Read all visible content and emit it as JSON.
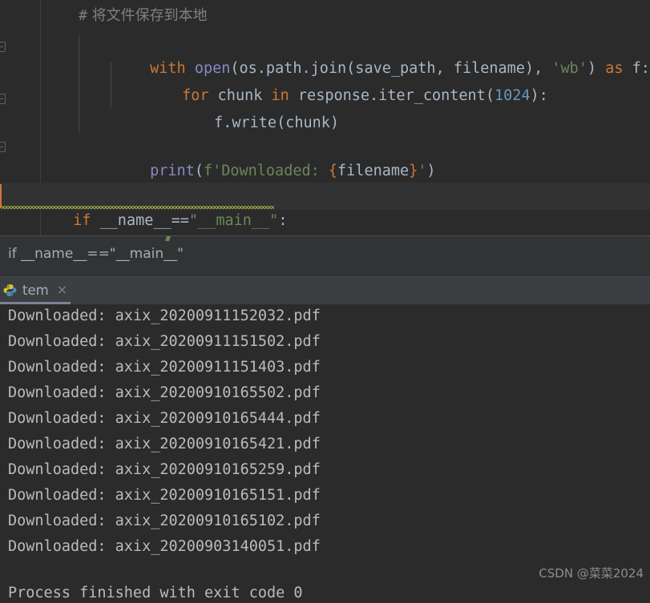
{
  "editor": {
    "comment_line": "# 将文件保存到本地",
    "comment_hash": "#",
    "comment_text": " 将文件保存到本地",
    "lines": [
      {
        "indent": 0,
        "tokens": [
          {
            "t": "with",
            "c": "kw"
          },
          {
            "t": " ",
            "c": "plain"
          },
          {
            "t": "open",
            "c": "fn"
          },
          {
            "t": "(os.path.join(save_path, filename), ",
            "c": "plain"
          },
          {
            "t": "'wb'",
            "c": "str"
          },
          {
            "t": ") ",
            "c": "plain"
          },
          {
            "t": "as",
            "c": "kw"
          },
          {
            "t": " f:",
            "c": "plain"
          }
        ]
      },
      {
        "indent": 1,
        "tokens": [
          {
            "t": "for",
            "c": "kw"
          },
          {
            "t": " chunk ",
            "c": "plain"
          },
          {
            "t": "in",
            "c": "kw"
          },
          {
            "t": " response.iter_content(",
            "c": "plain"
          },
          {
            "t": "1024",
            "c": "num"
          },
          {
            "t": "):",
            "c": "plain"
          }
        ]
      },
      {
        "indent": 2,
        "tokens": [
          {
            "t": "f.write(chunk)",
            "c": "plain"
          }
        ]
      },
      {
        "indent": 0,
        "tokens": [
          {
            "t": "print",
            "c": "fn"
          },
          {
            "t": "(",
            "c": "plain"
          },
          {
            "t": "f'Downloaded: ",
            "c": "str"
          },
          {
            "t": "{",
            "c": "brace"
          },
          {
            "t": "filename",
            "c": "plain"
          },
          {
            "t": "}",
            "c": "brace"
          },
          {
            "t": "'",
            "c": "str"
          },
          {
            "t": ")",
            "c": "plain"
          }
        ]
      }
    ],
    "main_guard": [
      {
        "t": "if",
        "c": "kw"
      },
      {
        "t": " __name__",
        "c": "plain"
      },
      {
        "t": "==",
        "c": "plain"
      },
      {
        "t": "\"__main__\"",
        "c": "str"
      },
      {
        "t": ":",
        "c": "plain"
      }
    ]
  },
  "breadcrumb": {
    "path": "if __name__==\"__main__\""
  },
  "toolwindow": {
    "tab_label": "tem",
    "tab_close": "×",
    "tab_icon": "python-icon"
  },
  "console": {
    "lines": [
      "Downloaded: axix_20200911152032.pdf",
      "Downloaded: axix_20200911151502.pdf",
      "Downloaded: axix_20200911151403.pdf",
      "Downloaded: axix_20200910165502.pdf",
      "Downloaded: axix_20200910165444.pdf",
      "Downloaded: axix_20200910165421.pdf",
      "Downloaded: axix_20200910165259.pdf",
      "Downloaded: axix_20200910165151.pdf",
      "Downloaded: axix_20200910165102.pdf",
      "Downloaded: axix_20200903140051.pdf",
      "",
      "Process finished with exit code 0"
    ]
  },
  "watermark": {
    "text": "CSDN @菜菜2024"
  },
  "colors": {
    "editor_bg": "#2b2b2b",
    "panel_bg": "#3c3f41",
    "breadcrumb_bg": "#313335",
    "keyword": "#cc7832",
    "function": "#8888c6",
    "string": "#6a8759",
    "number": "#6897bb",
    "plain": "#a9b7c6",
    "console_text": "#bbbbbb",
    "comment": "#808080",
    "warning_squiggle": "#a5a548",
    "tab_underline": "#7a8392"
  }
}
